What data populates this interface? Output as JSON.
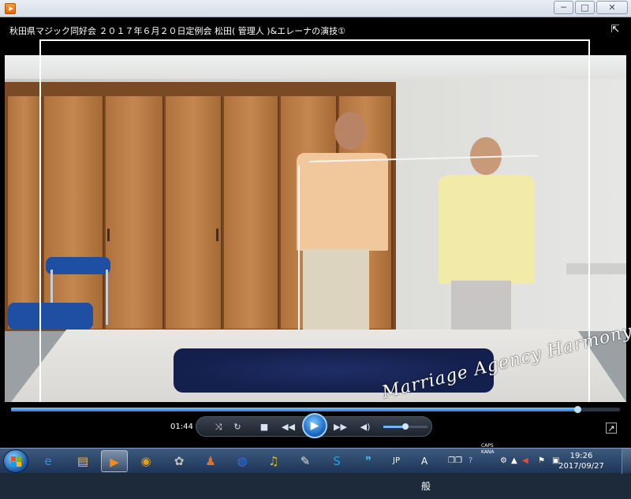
{
  "window": {
    "title": "秋田県マジック同好会 ２０１７年６月２０日定例会 松田( 管理人 )&エレーナの演技①",
    "buttons": {
      "minimize": "─",
      "maximize": "□",
      "close": "✕"
    },
    "view_toggle_icon": "switch-to-library-icon"
  },
  "video": {
    "watermark": "Marriage Agency Harmony"
  },
  "player": {
    "elapsed": "01:44",
    "progress_fraction": 0.93,
    "volume_fraction": 0.5,
    "icons": [
      "shuffle-icon",
      "repeat-icon",
      "stop-icon",
      "previous-icon",
      "play-icon",
      "next-icon",
      "volume-icon",
      "fullscreen-icon"
    ]
  },
  "taskbar": {
    "pinned": [
      {
        "name": "ie",
        "icon": "e",
        "color": "#3a8be0"
      },
      {
        "name": "explorer",
        "icon": "▤",
        "color": "#f0c050"
      },
      {
        "name": "media-player",
        "icon": "▶",
        "color": "#f38a1c",
        "active": true
      },
      {
        "name": "app-3",
        "icon": "◉",
        "color": "#e0a020"
      },
      {
        "name": "app-4",
        "icon": "✿",
        "color": "#c0c0c0"
      },
      {
        "name": "app-5",
        "icon": "♟",
        "color": "#e07030"
      },
      {
        "name": "app-6",
        "icon": "◍",
        "color": "#3070e0"
      },
      {
        "name": "app-7",
        "icon": "♫",
        "color": "#e0c020"
      },
      {
        "name": "paint",
        "icon": "✎",
        "color": "#e0e0e0"
      },
      {
        "name": "skype",
        "icon": "S",
        "color": "#1fa4e8"
      },
      {
        "name": "chat",
        "icon": "❞",
        "color": "#3ab0e8"
      }
    ],
    "tray": {
      "lang": "JP",
      "ime": "A 般",
      "caps": "CAPS",
      "kana": "KANA"
    },
    "clock": {
      "time": "19:26",
      "date": "2017/09/27"
    }
  }
}
